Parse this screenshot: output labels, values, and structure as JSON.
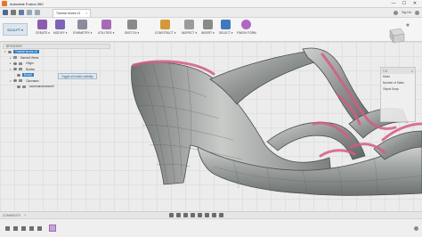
{
  "window": {
    "title": "Autodesk Fusion 360",
    "minimize": "—",
    "maximize": "☐",
    "close": "✕"
  },
  "tabbar": {
    "doc_tab": "Tutorial shoes v2",
    "tab_close": "×",
    "user_name": "Tay He"
  },
  "ribbon": {
    "workspace": "SCULPT ▾",
    "groups": [
      {
        "label": "CREATE ▾",
        "color": "#8e5bb3"
      },
      {
        "label": "MODIFY ▾",
        "color": "#7d62b5"
      },
      {
        "label": "SYMMETRY ▾",
        "color": "#8b8b9b"
      },
      {
        "label": "UTILITIES ▾",
        "color": "#a66bb6"
      },
      {
        "label": "SKETCH ▾",
        "color": "#8a8a8a"
      },
      {
        "label": "CONSTRUCT ▾",
        "color": "#d39a37"
      },
      {
        "label": "INSPECT ▾",
        "color": "#9b9b9b"
      },
      {
        "label": "INSERT ▾",
        "color": "#8a8a8a"
      },
      {
        "label": "SELECT ▾",
        "color": "#3f79c0"
      },
      {
        "label": "FINISH FORM",
        "color": "#b067c2"
      }
    ]
  },
  "browser": {
    "header": "BROWSER",
    "items": [
      {
        "label": "Tutorial shoes v2",
        "type": "root"
      },
      {
        "label": "Named Views",
        "type": "folder"
      },
      {
        "label": "Origin",
        "type": "folder"
      },
      {
        "label": "Bodies",
        "type": "folder"
      },
      {
        "label": "Body1",
        "type": "selected"
      },
      {
        "label": "Canvases",
        "type": "folder"
      },
      {
        "label": "cavemanshoeshell",
        "type": "item"
      }
    ],
    "tooltip": "Toggle all bodies visibility"
  },
  "right_panel": {
    "title": "T-S",
    "close": "×",
    "rows": [
      "Mode",
      "Number of Sides",
      "Object Snap"
    ]
  },
  "viewcube": {
    "face": "FRONT"
  },
  "bottom": {
    "comments": "COMMENTS",
    "comments_plus": "+"
  },
  "colors": {
    "shoe_body": "#8a8e8c",
    "shoe_highlight": "#d9dbd9",
    "edge_magenta": "#d45c86",
    "selection_blue": "#2f7dc5"
  }
}
